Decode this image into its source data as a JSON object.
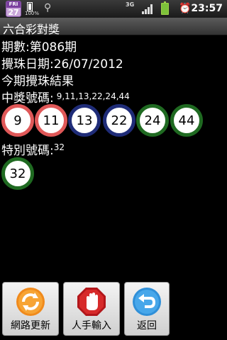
{
  "status_bar": {
    "calendar_day_of_week": "FRI",
    "calendar_day": "27",
    "battery_small_percent": "100%",
    "network": "3G",
    "clock": "23:57"
  },
  "title": "六合彩對獎",
  "draw": {
    "period_label": "期數:第086期",
    "date_label": "攪珠日期:26/07/2012",
    "results_heading": "今期攪珠結果",
    "winning_label": "中獎號碼:",
    "winning_numbers_text": "9,11,13,22,24,44",
    "balls": [
      {
        "number": "9",
        "color": "red"
      },
      {
        "number": "11",
        "color": "red"
      },
      {
        "number": "13",
        "color": "blue"
      },
      {
        "number": "22",
        "color": "blue"
      },
      {
        "number": "24",
        "color": "green"
      },
      {
        "number": "44",
        "color": "green"
      }
    ],
    "special_label": "特別號碼:",
    "special_number_text": "32",
    "special_ball": {
      "number": "32",
      "color": "green"
    }
  },
  "buttons": {
    "update": "網路更新",
    "manual": "人手輸入",
    "back": "返回"
  },
  "colors": {
    "red_ball": "#e05858",
    "blue_ball": "#1f2c78",
    "green_ball": "#1f6a21"
  },
  "icons": {
    "update": "refresh-icon",
    "manual": "hand-stop-icon",
    "back": "back-arrow-icon"
  }
}
